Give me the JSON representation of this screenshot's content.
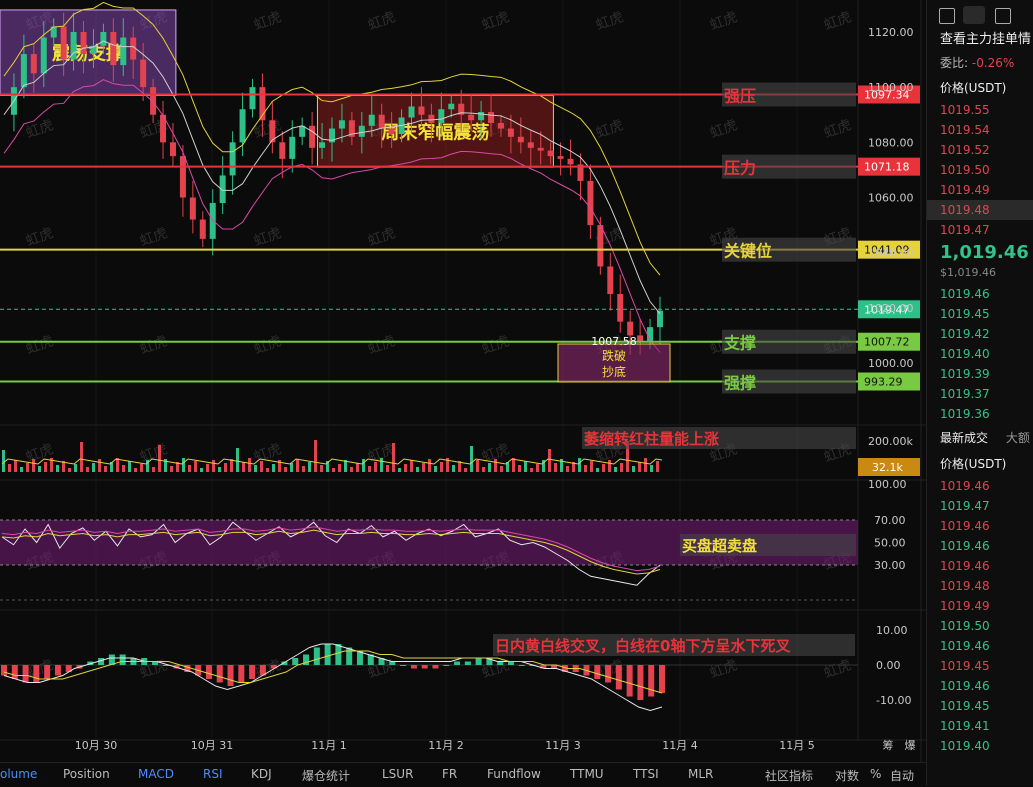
{
  "chart_data": {
    "type": "candlestick",
    "y_ticks": [
      "1120.00",
      "1100.00",
      "1080.00",
      "1060.00",
      "1040.00",
      "1020.00",
      "1000.00"
    ],
    "x_ticks": [
      "10月 30",
      "10月 31",
      "11月 1",
      "11月 2",
      "11月 3",
      "11月 4",
      "11月 5"
    ],
    "price_range": [
      990,
      1130
    ],
    "current_price": "1019.47",
    "levels": [
      {
        "name": "强压",
        "value": 1097.34,
        "label": "1097.34",
        "color": "#e8333b"
      },
      {
        "name": "压力",
        "value": 1071.18,
        "label": "1071.18",
        "color": "#e8333b"
      },
      {
        "name": "关键位",
        "value": 1041.09,
        "label": "1041.09",
        "color": "#e6d23a"
      },
      {
        "name": "支撑",
        "value": 1007.72,
        "label": "1007.72",
        "color": "#7ac943"
      },
      {
        "name": "强撑",
        "value": 993.29,
        "label": "993.29",
        "color": "#7ac943"
      }
    ],
    "boxes": [
      {
        "label": "震荡支撑",
        "x0": 0.0,
        "x1": 0.205,
        "y0": 1128,
        "y1": 1097
      },
      {
        "label": "周末窄幅震荡",
        "x0": 0.37,
        "x1": 0.645,
        "y0": 1097,
        "y1": 1071
      }
    ],
    "low_marker": {
      "value": "1007.58",
      "label1": "跌破",
      "label2": "抄底"
    },
    "price_path": [
      1090,
      1100,
      1112,
      1105,
      1118,
      1122,
      1110,
      1120,
      1112,
      1115,
      1120,
      1108,
      1118,
      1110,
      1100,
      1090,
      1080,
      1075,
      1060,
      1052,
      1045,
      1058,
      1068,
      1080,
      1092,
      1100,
      1088,
      1080,
      1074,
      1082,
      1086,
      1078,
      1080,
      1085,
      1088,
      1082,
      1086,
      1090,
      1085,
      1083,
      1089,
      1093,
      1090,
      1087,
      1092,
      1094,
      1090,
      1088,
      1091,
      1087,
      1085,
      1082,
      1080,
      1078,
      1077,
      1075,
      1074,
      1072,
      1066,
      1050,
      1035,
      1025,
      1015,
      1010,
      1008,
      1013,
      1019
    ],
    "volume": {
      "axis_ticks": [
        "200.00k",
        "100.00"
      ],
      "current": "32.1k",
      "annotation": "萎缩转红柱量能上涨"
    },
    "rsi": {
      "axis_ticks": [
        "70.00",
        "50.00",
        "30.00"
      ],
      "annotation": "买盘超卖盘",
      "line_white": [
        55,
        48,
        62,
        50,
        66,
        45,
        58,
        63,
        52,
        60,
        47,
        62,
        55,
        57,
        66,
        50,
        58,
        62,
        48,
        55,
        68,
        60,
        52,
        58,
        64,
        55,
        60,
        68,
        56,
        50,
        62,
        58,
        65,
        55,
        60,
        52,
        58,
        62,
        56,
        60,
        66,
        55,
        58,
        62,
        52,
        48,
        50,
        46,
        40,
        34,
        26,
        20,
        18,
        16,
        14,
        12,
        22,
        30
      ],
      "line_yellow": [
        55,
        54,
        56,
        55,
        58,
        56,
        57,
        58,
        56,
        57,
        55,
        57,
        57,
        58,
        59,
        57,
        58,
        59,
        56,
        57,
        59,
        59,
        57,
        58,
        60,
        58,
        59,
        61,
        59,
        57,
        58,
        58,
        59,
        58,
        58,
        57,
        57,
        58,
        57,
        58,
        59,
        58,
        58,
        58,
        56,
        54,
        52,
        50,
        47,
        43,
        38,
        33,
        29,
        26,
        24,
        22,
        23,
        26
      ]
    },
    "macd": {
      "axis_ticks": [
        "10.00",
        "0.00",
        "-10.00"
      ],
      "annotation": "日内黄白线交叉，白线在0轴下方呈水下死叉",
      "hist": [
        -3,
        -4,
        -5,
        -5,
        -4,
        -3,
        -2,
        -1,
        1,
        2,
        3,
        3,
        2,
        2,
        1,
        0,
        -1,
        -2,
        -3,
        -4,
        -5,
        -6,
        -5,
        -4,
        -3,
        -1,
        1,
        2,
        3,
        5,
        6,
        6,
        5,
        4,
        3,
        2,
        1,
        0,
        -1,
        -1,
        -1,
        0,
        1,
        1,
        2,
        2,
        1,
        1,
        0,
        0,
        -1,
        -1,
        -2,
        -2,
        -3,
        -4,
        -5,
        -7,
        -9,
        -10,
        -9,
        -8
      ],
      "dif": [
        -3,
        -4,
        -5,
        -5,
        -4,
        -3,
        -1,
        0,
        1,
        2,
        2,
        2,
        1,
        1,
        0,
        -1,
        -2,
        -4,
        -6,
        -7,
        -6,
        -5,
        -3,
        -1,
        1,
        3,
        5,
        6,
        6,
        5,
        4,
        3,
        2,
        1,
        1,
        1,
        1,
        1,
        1,
        2,
        2,
        2,
        1,
        1,
        1,
        0,
        -1,
        -1,
        -2,
        -3,
        -4,
        -6,
        -8,
        -10,
        -12,
        -13,
        -12
      ],
      "dea": [
        -2,
        -3,
        -3,
        -4,
        -4,
        -4,
        -3,
        -2,
        -1,
        0,
        1,
        1,
        1,
        1,
        1,
        0,
        -1,
        -2,
        -3,
        -4,
        -5,
        -5,
        -4,
        -3,
        -2,
        0,
        1,
        2,
        3,
        4,
        4,
        4,
        3,
        3,
        2,
        2,
        2,
        2,
        2,
        2,
        2,
        2,
        2,
        1,
        1,
        1,
        0,
        0,
        -1,
        -1,
        -2,
        -3,
        -4,
        -5,
        -6,
        -7,
        -8
      ]
    }
  },
  "toolbar": {
    "items": [
      "olume",
      "Position",
      "MACD",
      "RSI",
      "KDJ",
      "爆仓统计",
      "LSUR",
      "FR",
      "Fundflow",
      "TTMU",
      "TTSI",
      "MLR",
      "社区指标",
      "对数",
      "%",
      "自动"
    ]
  },
  "corner_labels": {
    "left": "筹",
    "right": "爆"
  },
  "watermark": "虹虎",
  "panel": {
    "title": "查看主力挂单情",
    "ratio_label": "委比:",
    "ratio_value": "-0.26%",
    "price_header": "价格(USDT)",
    "asks": [
      "1019.55",
      "1019.54",
      "1019.52",
      "1019.50",
      "1019.49",
      "1019.48",
      "1019.47"
    ],
    "last_price": "1,019.46",
    "last_price_usd": "$1,019.46",
    "bids": [
      "1019.46",
      "1019.45",
      "1019.42",
      "1019.40",
      "1019.39",
      "1019.37",
      "1019.36"
    ],
    "trades_tab": "最新成交",
    "trades_tab2": "大额",
    "trades_header": "价格(USDT)",
    "trades": [
      {
        "p": "1019.46",
        "c": "red"
      },
      {
        "p": "1019.47",
        "c": "green"
      },
      {
        "p": "1019.46",
        "c": "red"
      },
      {
        "p": "1019.46",
        "c": "green"
      },
      {
        "p": "1019.46",
        "c": "red"
      },
      {
        "p": "1019.48",
        "c": "red"
      },
      {
        "p": "1019.49",
        "c": "red"
      },
      {
        "p": "1019.50",
        "c": "green"
      },
      {
        "p": "1019.46",
        "c": "green"
      },
      {
        "p": "1019.45",
        "c": "red"
      },
      {
        "p": "1019.46",
        "c": "green"
      },
      {
        "p": "1019.45",
        "c": "green"
      },
      {
        "p": "1019.41",
        "c": "green"
      },
      {
        "p": "1019.40",
        "c": "green"
      }
    ]
  }
}
